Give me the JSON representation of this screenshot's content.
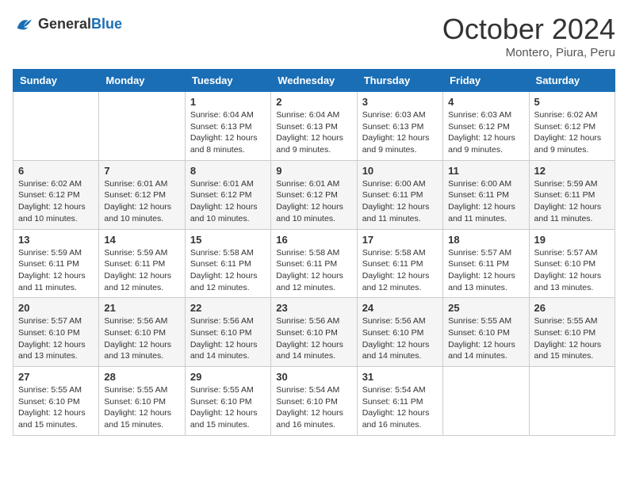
{
  "header": {
    "logo_general": "General",
    "logo_blue": "Blue",
    "month_title": "October 2024",
    "location": "Montero, Piura, Peru"
  },
  "days_of_week": [
    "Sunday",
    "Monday",
    "Tuesday",
    "Wednesday",
    "Thursday",
    "Friday",
    "Saturday"
  ],
  "weeks": [
    [
      {
        "day": "",
        "info": ""
      },
      {
        "day": "",
        "info": ""
      },
      {
        "day": "1",
        "info": "Sunrise: 6:04 AM\nSunset: 6:13 PM\nDaylight: 12 hours and 8 minutes."
      },
      {
        "day": "2",
        "info": "Sunrise: 6:04 AM\nSunset: 6:13 PM\nDaylight: 12 hours and 9 minutes."
      },
      {
        "day": "3",
        "info": "Sunrise: 6:03 AM\nSunset: 6:13 PM\nDaylight: 12 hours and 9 minutes."
      },
      {
        "day": "4",
        "info": "Sunrise: 6:03 AM\nSunset: 6:12 PM\nDaylight: 12 hours and 9 minutes."
      },
      {
        "day": "5",
        "info": "Sunrise: 6:02 AM\nSunset: 6:12 PM\nDaylight: 12 hours and 9 minutes."
      }
    ],
    [
      {
        "day": "6",
        "info": "Sunrise: 6:02 AM\nSunset: 6:12 PM\nDaylight: 12 hours and 10 minutes."
      },
      {
        "day": "7",
        "info": "Sunrise: 6:01 AM\nSunset: 6:12 PM\nDaylight: 12 hours and 10 minutes."
      },
      {
        "day": "8",
        "info": "Sunrise: 6:01 AM\nSunset: 6:12 PM\nDaylight: 12 hours and 10 minutes."
      },
      {
        "day": "9",
        "info": "Sunrise: 6:01 AM\nSunset: 6:12 PM\nDaylight: 12 hours and 10 minutes."
      },
      {
        "day": "10",
        "info": "Sunrise: 6:00 AM\nSunset: 6:11 PM\nDaylight: 12 hours and 11 minutes."
      },
      {
        "day": "11",
        "info": "Sunrise: 6:00 AM\nSunset: 6:11 PM\nDaylight: 12 hours and 11 minutes."
      },
      {
        "day": "12",
        "info": "Sunrise: 5:59 AM\nSunset: 6:11 PM\nDaylight: 12 hours and 11 minutes."
      }
    ],
    [
      {
        "day": "13",
        "info": "Sunrise: 5:59 AM\nSunset: 6:11 PM\nDaylight: 12 hours and 11 minutes."
      },
      {
        "day": "14",
        "info": "Sunrise: 5:59 AM\nSunset: 6:11 PM\nDaylight: 12 hours and 12 minutes."
      },
      {
        "day": "15",
        "info": "Sunrise: 5:58 AM\nSunset: 6:11 PM\nDaylight: 12 hours and 12 minutes."
      },
      {
        "day": "16",
        "info": "Sunrise: 5:58 AM\nSunset: 6:11 PM\nDaylight: 12 hours and 12 minutes."
      },
      {
        "day": "17",
        "info": "Sunrise: 5:58 AM\nSunset: 6:11 PM\nDaylight: 12 hours and 12 minutes."
      },
      {
        "day": "18",
        "info": "Sunrise: 5:57 AM\nSunset: 6:11 PM\nDaylight: 12 hours and 13 minutes."
      },
      {
        "day": "19",
        "info": "Sunrise: 5:57 AM\nSunset: 6:10 PM\nDaylight: 12 hours and 13 minutes."
      }
    ],
    [
      {
        "day": "20",
        "info": "Sunrise: 5:57 AM\nSunset: 6:10 PM\nDaylight: 12 hours and 13 minutes."
      },
      {
        "day": "21",
        "info": "Sunrise: 5:56 AM\nSunset: 6:10 PM\nDaylight: 12 hours and 13 minutes."
      },
      {
        "day": "22",
        "info": "Sunrise: 5:56 AM\nSunset: 6:10 PM\nDaylight: 12 hours and 14 minutes."
      },
      {
        "day": "23",
        "info": "Sunrise: 5:56 AM\nSunset: 6:10 PM\nDaylight: 12 hours and 14 minutes."
      },
      {
        "day": "24",
        "info": "Sunrise: 5:56 AM\nSunset: 6:10 PM\nDaylight: 12 hours and 14 minutes."
      },
      {
        "day": "25",
        "info": "Sunrise: 5:55 AM\nSunset: 6:10 PM\nDaylight: 12 hours and 14 minutes."
      },
      {
        "day": "26",
        "info": "Sunrise: 5:55 AM\nSunset: 6:10 PM\nDaylight: 12 hours and 15 minutes."
      }
    ],
    [
      {
        "day": "27",
        "info": "Sunrise: 5:55 AM\nSunset: 6:10 PM\nDaylight: 12 hours and 15 minutes."
      },
      {
        "day": "28",
        "info": "Sunrise: 5:55 AM\nSunset: 6:10 PM\nDaylight: 12 hours and 15 minutes."
      },
      {
        "day": "29",
        "info": "Sunrise: 5:55 AM\nSunset: 6:10 PM\nDaylight: 12 hours and 15 minutes."
      },
      {
        "day": "30",
        "info": "Sunrise: 5:54 AM\nSunset: 6:10 PM\nDaylight: 12 hours and 16 minutes."
      },
      {
        "day": "31",
        "info": "Sunrise: 5:54 AM\nSunset: 6:11 PM\nDaylight: 12 hours and 16 minutes."
      },
      {
        "day": "",
        "info": ""
      },
      {
        "day": "",
        "info": ""
      }
    ]
  ]
}
